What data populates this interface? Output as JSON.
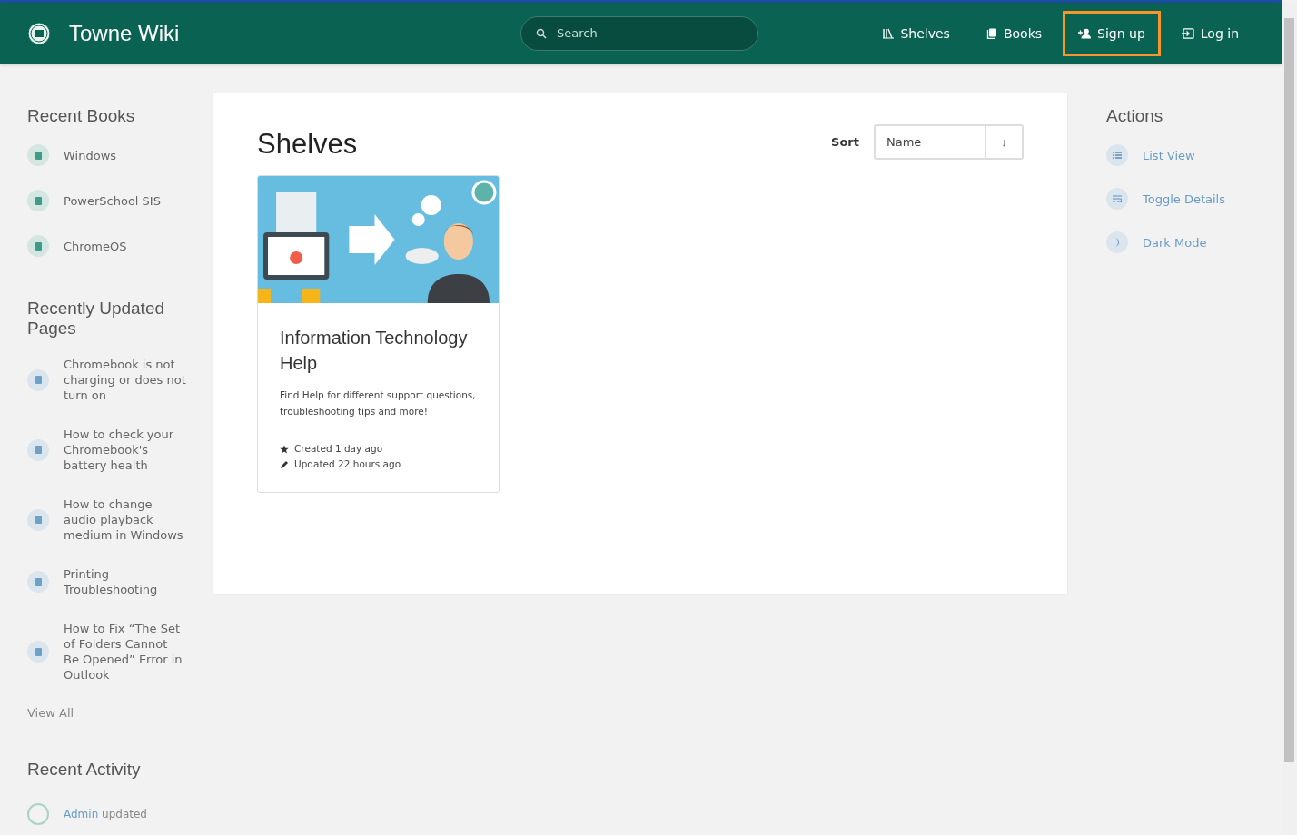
{
  "header": {
    "title": "Towne Wiki",
    "search": {
      "placeholder": "Search"
    },
    "nav": [
      {
        "kind": "shelves",
        "label": "Shelves",
        "highlighted": false
      },
      {
        "kind": "books",
        "label": "Books",
        "highlighted": false
      },
      {
        "kind": "signup",
        "label": "Sign up",
        "highlighted": true
      },
      {
        "kind": "login",
        "label": "Log in",
        "highlighted": false
      }
    ]
  },
  "left": {
    "recent_books": {
      "title": "Recent Books",
      "items": [
        "Windows",
        "PowerSchool SIS",
        "ChromeOS"
      ]
    },
    "recent_pages": {
      "title": "Recently Updated Pages",
      "items": [
        "Chromebook is not charging or does not turn on",
        "How to check your Chromebook's battery health",
        "How to change audio playback medium in Windows",
        "Printing Troubleshooting",
        "How to Fix “The Set of Folders Cannot Be Opened” Error in Outlook"
      ],
      "view_all": "View All"
    },
    "recent_activity": {
      "title": "Recent Activity",
      "items": [
        {
          "user": "Admin",
          "action": "updated"
        }
      ]
    }
  },
  "main": {
    "title": "Shelves",
    "sort": {
      "label": "Sort",
      "value": "Name",
      "direction": "↓"
    },
    "shelves": [
      {
        "kind": "picture",
        "title": "Information Technology Help",
        "description": "Find Help for different support questions, troubleshooting tips and more!",
        "created": "Created 1 day ago",
        "updated": "Updated 22 hours ago"
      }
    ]
  },
  "actions": {
    "title": "Actions",
    "items": [
      {
        "kind": "list",
        "label": "List View"
      },
      {
        "kind": "details",
        "label": "Toggle Details"
      },
      {
        "kind": "dark",
        "label": "Dark Mode"
      }
    ]
  }
}
